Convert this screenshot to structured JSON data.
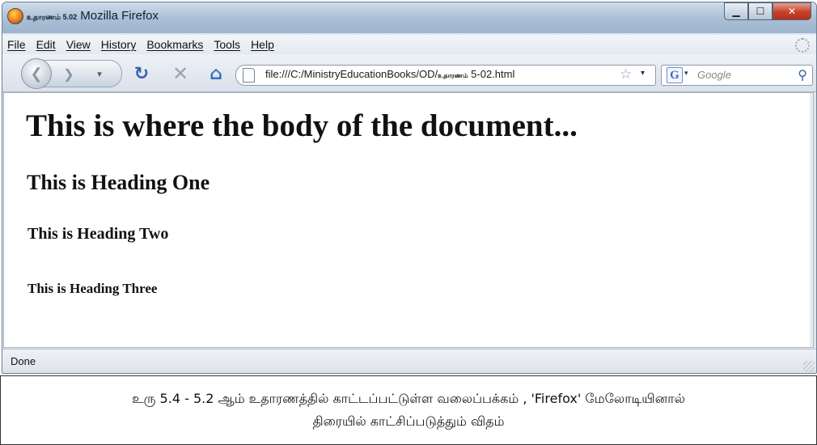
{
  "window": {
    "title_prefix": "உதாரணம் 5.02",
    "title": "Mozilla Firefox",
    "minimize_symbol": "▁",
    "maximize_symbol": "☐",
    "close_symbol": "✕"
  },
  "menubar": {
    "items": [
      "File",
      "Edit",
      "View",
      "History",
      "Bookmarks",
      "Tools",
      "Help"
    ]
  },
  "toolbar": {
    "back_icon": "back-arrow-icon",
    "forward_icon": "forward-arrow-icon",
    "reload_icon": "reload-icon",
    "stop_icon": "stop-icon",
    "home_icon": "home-icon",
    "url_prefix": "file:///C:/MinistryEducationBooks/OD/",
    "url_tamil": "உதாரணம்",
    "url_suffix": " 5-02.html",
    "search_engine": "G",
    "search_placeholder": "Google"
  },
  "document": {
    "h1": "This is where the body of the document...",
    "h2": "This is Heading One",
    "h3": "This is Heading Two",
    "h4": "This is Heading Three"
  },
  "statusbar": {
    "text": "Done"
  },
  "caption": {
    "line1": "உரு 5.4 - 5.2 ஆம் உதாரணத்தில் காட்டப்பட்டுள்ள வலைப்பக்கம் , 'Firefox' மேலோடியினால்",
    "line2": "திரையில் காட்சிப்படுத்தும் விதம்"
  },
  "colors": {
    "titlebar": "#a9bfd6",
    "close_button": "#c6412a",
    "link_blue": "#3a5fb5"
  }
}
